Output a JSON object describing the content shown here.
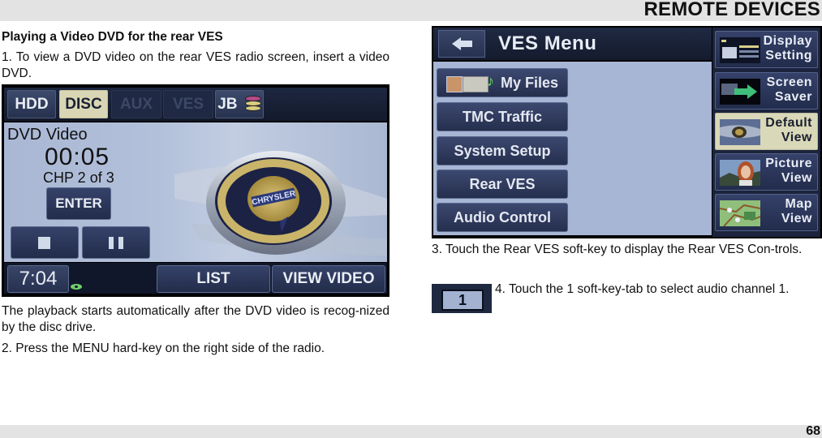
{
  "header": {
    "section_title": "REMOTE DEVICES"
  },
  "footer": {
    "page_number": "68"
  },
  "left_column": {
    "heading": "Playing a Video DVD for the rear VES",
    "step1": "1. To view a DVD video on the rear VES radio screen, insert a video DVD.",
    "after_screen": "The playback starts automatically after the DVD video is recog-nized by the disc drive.",
    "step2": "2. Press the MENU hard-key on the right side of the radio."
  },
  "dvd_screen": {
    "tabs": [
      {
        "label": "HDD",
        "state": "normal"
      },
      {
        "label": "DISC",
        "state": "active"
      },
      {
        "label": "AUX",
        "state": "disabled"
      },
      {
        "label": "VES",
        "state": "disabled"
      },
      {
        "label": "JB",
        "state": "normal",
        "icon": "disc-stack-icon"
      }
    ],
    "media_label": "DVD Video",
    "elapsed_time": "00:05",
    "chapter": "CHP 2 of 3",
    "enter_label": "ENTER",
    "stop_icon": "stop-icon",
    "pause_icon": "pause-icon",
    "clock": "7:04",
    "list_label": "LIST",
    "view_video_label": "VIEW VIDEO",
    "emblem_text": "CHRYSLER"
  },
  "ves_menu_screen": {
    "title": "VES Menu",
    "back_icon": "back-arrow-icon",
    "menu_items": [
      {
        "label": "My Files",
        "icon": "my-files-icon"
      },
      {
        "label": "TMC Traffic"
      },
      {
        "label": "System Setup"
      },
      {
        "label": "Rear VES"
      },
      {
        "label": "Audio Control"
      }
    ],
    "side_items": [
      {
        "line1": "Display",
        "line2": "Setting",
        "state": "normal"
      },
      {
        "line1": "Screen",
        "line2": "Saver",
        "state": "normal"
      },
      {
        "line1": "Default",
        "line2": "View",
        "state": "active"
      },
      {
        "line1": "Picture",
        "line2": "View",
        "state": "normal"
      },
      {
        "line1": "Map",
        "line2": "View",
        "state": "normal"
      }
    ]
  },
  "right_column": {
    "step3": "3. Touch the Rear VES soft-key to display the Rear VES Con-trols.",
    "tab_icon_label": "1",
    "step4": "4. Touch the 1 soft-key-tab to select audio channel 1."
  },
  "colors": {
    "band_gray": "#e3e3e3",
    "screen_navy": "#222c4a",
    "screen_body_blue": "#a7b6d4",
    "active_tab": "#d8d6b4"
  }
}
